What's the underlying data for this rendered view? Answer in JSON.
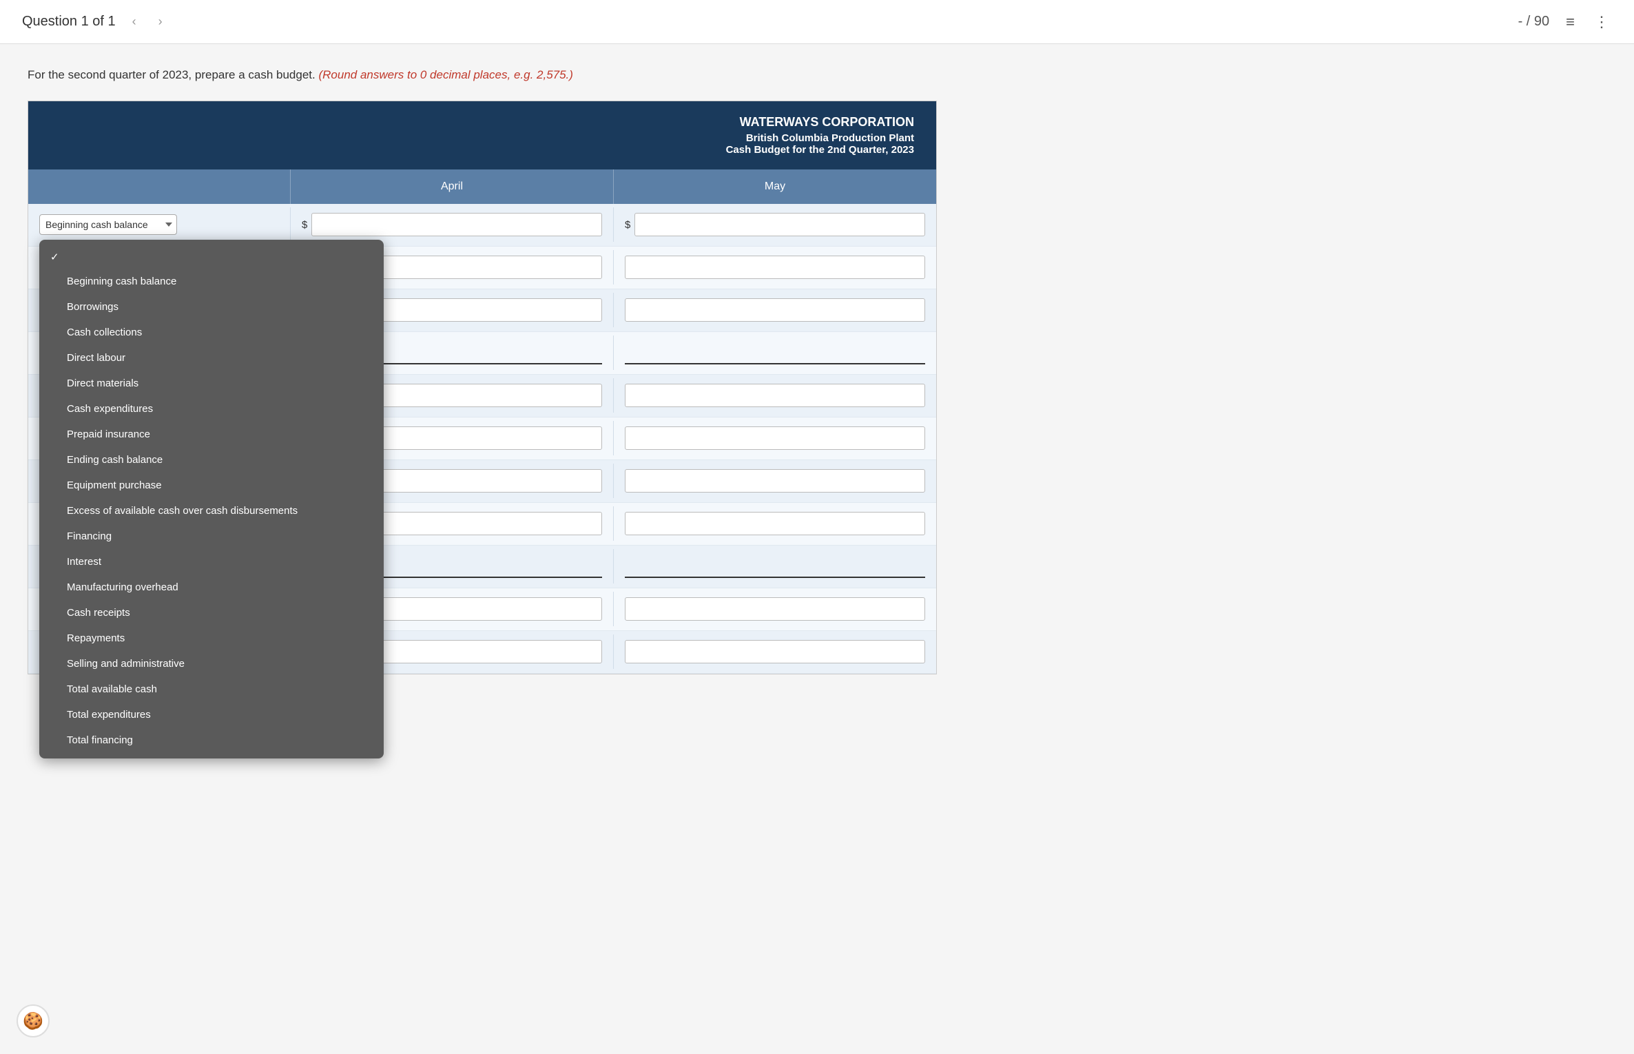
{
  "nav": {
    "title": "Question 1 of 1",
    "prev_arrow": "‹",
    "next_arrow": "›",
    "score": "- / 90",
    "list_icon": "≡",
    "more_icon": "⋮"
  },
  "question": {
    "text": "For the second quarter of 2023, prepare a cash budget.",
    "highlight": "(Round answers to 0 decimal places, e.g. 2,575.)"
  },
  "table": {
    "corp_name": "WATERWAYS CORPORATION",
    "corp_subtitle": "British Columbia Production Plant",
    "corp_period": "Cash Budget for the 2nd Quarter, 2023",
    "columns": [
      "April",
      "May"
    ],
    "rows": [
      {
        "type": "select",
        "label": "",
        "has_dollar": true,
        "underline": false
      },
      {
        "type": "select",
        "label": "",
        "has_dollar": false,
        "underline": false
      },
      {
        "type": "input_only",
        "label": "",
        "has_dollar": false,
        "underline": false
      },
      {
        "type": "input_only",
        "label": "",
        "has_dollar": false,
        "underline": true
      },
      {
        "type": "select",
        "label": "",
        "has_dollar": false,
        "underline": false
      },
      {
        "type": "input_only",
        "label": "",
        "has_dollar": false,
        "underline": false
      },
      {
        "type": "input_only",
        "label": "",
        "has_dollar": false,
        "underline": false
      },
      {
        "type": "input_only",
        "label": "",
        "has_dollar": false,
        "underline": false
      },
      {
        "type": "input_only",
        "label": "",
        "has_dollar": false,
        "underline": true
      },
      {
        "type": "select",
        "label": "",
        "has_dollar": false,
        "underline": false
      }
    ]
  },
  "dropdown": {
    "items": [
      "Beginning cash balance",
      "Borrowings",
      "Cash collections",
      "Direct labour",
      "Direct materials",
      "Cash expenditures",
      "Prepaid insurance",
      "Ending cash balance",
      "Equipment purchase",
      "Excess of available cash over cash disbursements",
      "Financing",
      "Interest",
      "Manufacturing overhead",
      "Cash receipts",
      "Repayments",
      "Selling and administrative",
      "Total available cash",
      "Total expenditures",
      "Total financing"
    ]
  },
  "labels": {
    "beginning_cash_balance": "Beginning cash balance",
    "cash_collections": "Cash collections",
    "prepaid_insurance": "Prepaid insurance",
    "ending_cash_balance": "Ending cash balance",
    "cash_expenditures": "Cash expenditures",
    "manufacturing_overhead": "Manufacturing overhead",
    "cash_receipts": "Cash receipts",
    "selling_and_administrative": "Selling and administrative"
  },
  "cookie_icon": "🍪"
}
